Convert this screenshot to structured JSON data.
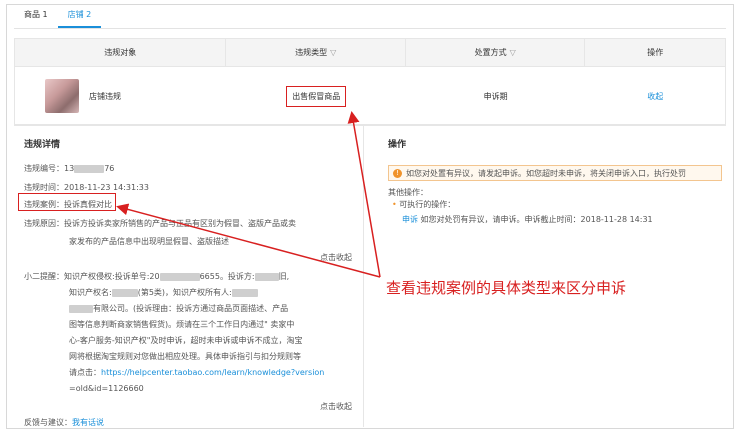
{
  "tabs": [
    "商品 1",
    "店铺 2"
  ],
  "table": {
    "headers": [
      "违规对象",
      "违规类型",
      "处置方式",
      "操作"
    ],
    "row": {
      "object": "店铺违规",
      "type": "出售假冒商品",
      "disposal": "申诉期",
      "action": "收起"
    }
  },
  "details": {
    "title": "违规详情",
    "id_label": "违规编号：",
    "id_prefix": "13",
    "id_suffix": "76",
    "time_label": "违规时间：",
    "time_value": "2018-11-23 14:31:33",
    "case_label": "违规案例：",
    "case_value": "投诉真假对比",
    "reason_label": "违规原因：",
    "reason_line1": "投诉方投诉卖家所销售的产品与正品有区别为假冒、盗版产品或卖",
    "reason_line2": "家发布的产品信息中出现明显假冒、盗版描述",
    "collapse1": "点击收起",
    "reminder_label": "小二提醒：",
    "reminder_line1_a": "知识产权侵权:投诉单号:20",
    "reminder_line1_b": "6655。投诉方:",
    "reminder_line1_c": "旧,",
    "reminder_line2_a": "知识产权名:",
    "reminder_line2_b": "(第5类)，知识产权所有人:",
    "reminder_line3": "有限公司。(投诉理由：投诉方通过商品页面描述、产品",
    "reminder_line4": "图等信息判断商家销售假货)。烦请在三个工作日内通过\" 卖家中",
    "reminder_line5": "心-客户服务-知识产权\"及时申诉，超时未申诉或申诉不成立，淘宝",
    "reminder_line6": "网将根据淘宝规则对您做出相应处理。具体申诉指引与扣分规则等",
    "reminder_line7_a": "请点击：",
    "reminder_link1": "https://helpcenter.taobao.com/learn/knowledge?version",
    "reminder_link2": "=old&id=1126660",
    "collapse2": "点击收起",
    "feedback_label": "反馈与建议：",
    "feedback_link": "我有话说"
  },
  "operation": {
    "title": "操作",
    "notice": "如您对处置有异议，请发起申诉。如您超时未申诉，将关闭申诉入口，执行处罚",
    "other_label": "其他操作：",
    "executable_label": "可执行的操作：",
    "appeal_link": "申诉",
    "appeal_desc": "如您对处罚有异议，请申诉。申诉截止时间：2018-11-28 14:31"
  },
  "annotation": "查看违规案例的具体类型来区分申诉",
  "colors": {
    "accent": "#1a8fd9",
    "annotation": "#d82020",
    "notice_icon": "#f0932b"
  }
}
